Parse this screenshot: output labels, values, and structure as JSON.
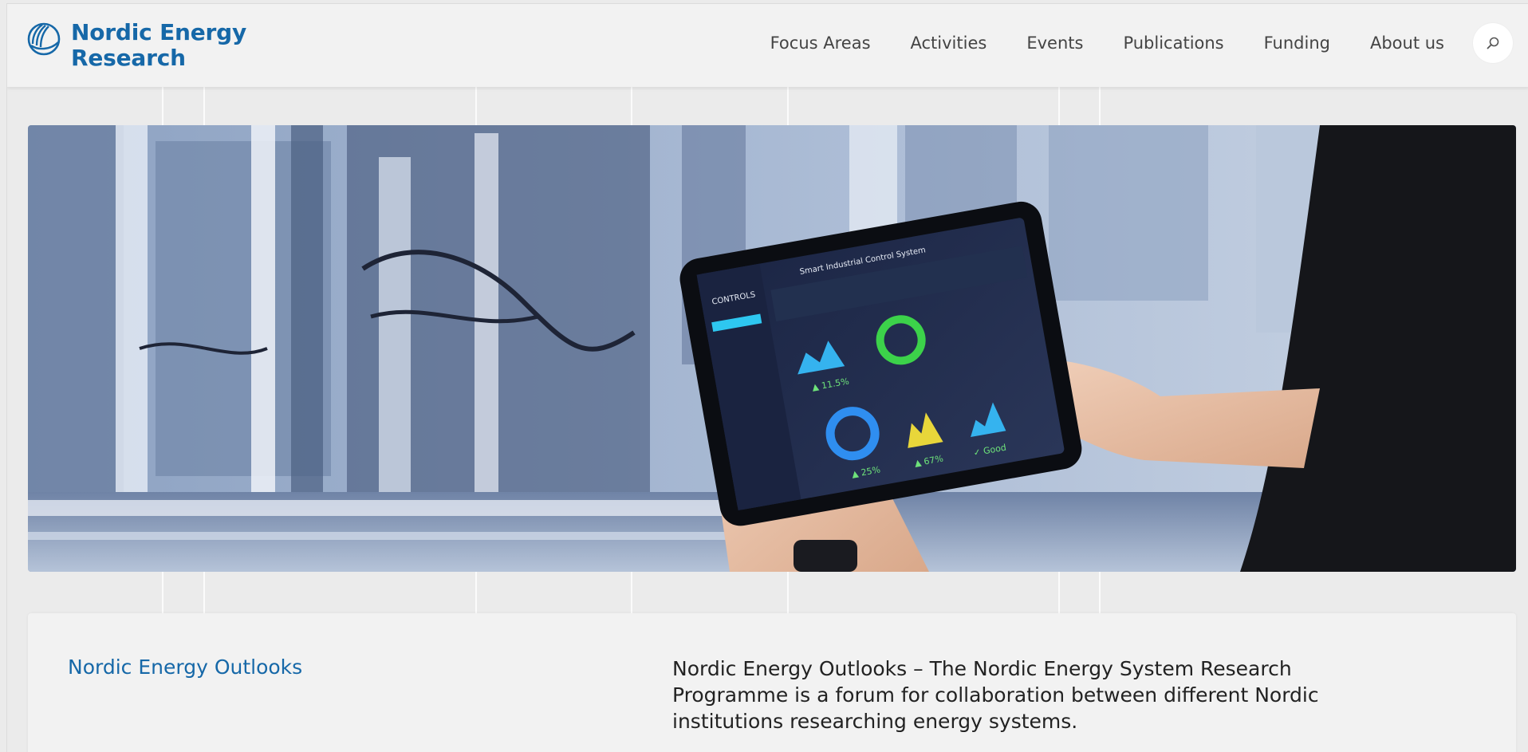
{
  "brand": {
    "line1": "Nordic Energy",
    "line2": "Research",
    "color": "#1668a8"
  },
  "nav": {
    "items": [
      "Focus Areas",
      "Activities",
      "Events",
      "Publications",
      "Funding",
      "About us"
    ],
    "search_icon": "search-icon"
  },
  "hero": {
    "image": "tablet-dashboard-factory",
    "tablet": {
      "header_text": "Smart Industrial Control System",
      "sidebar_label": "CONTROLS",
      "stats": [
        "11.5%",
        "25%",
        "67%",
        "Good"
      ]
    }
  },
  "intro": {
    "title": "Nordic Energy Outlooks",
    "description": "Nordic Energy Outlooks – The Nordic Energy System Research Programme is a forum for collaboration between different Nordic institutions researching energy systems."
  },
  "colors": {
    "accent": "#1668a8",
    "background": "#ebebeb",
    "header": "#f2f2f2"
  }
}
